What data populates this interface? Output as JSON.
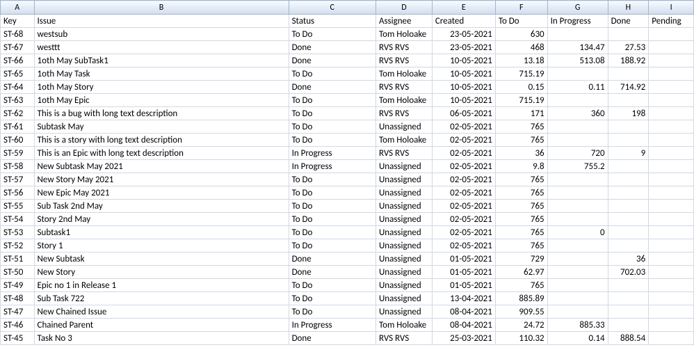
{
  "columns": [
    "A",
    "B",
    "C",
    "D",
    "E",
    "F",
    "G",
    "H",
    "I"
  ],
  "headerRow": {
    "key": "Key",
    "issue": "Issue",
    "status": "Status",
    "assignee": "Assignee",
    "created": "Created",
    "todo": "To Do",
    "inprogress": "In Progress",
    "done": "Done",
    "pending": "Pending"
  },
  "rows": [
    {
      "key": "ST-68",
      "issue": "westsub",
      "status": "To Do",
      "assignee": "Tom Holoake",
      "created": "23-05-2021",
      "todo": "630",
      "inprogress": "",
      "done": "",
      "pending": ""
    },
    {
      "key": "ST-67",
      "issue": "westtt",
      "status": "Done",
      "assignee": "RVS RVS",
      "created": "23-05-2021",
      "todo": "468",
      "inprogress": "134.47",
      "done": "27.53",
      "pending": ""
    },
    {
      "key": "ST-66",
      "issue": "1oth May SubTask1",
      "status": "Done",
      "assignee": "RVS RVS",
      "created": "10-05-2021",
      "todo": "13.18",
      "inprogress": "513.08",
      "done": "188.92",
      "pending": ""
    },
    {
      "key": "ST-65",
      "issue": "1oth May Task",
      "status": "To Do",
      "assignee": "Tom Holoake",
      "created": "10-05-2021",
      "todo": "715.19",
      "inprogress": "",
      "done": "",
      "pending": ""
    },
    {
      "key": "ST-64",
      "issue": "1oth May Story",
      "status": "Done",
      "assignee": "RVS RVS",
      "created": "10-05-2021",
      "todo": "0.15",
      "inprogress": "0.11",
      "done": "714.92",
      "pending": ""
    },
    {
      "key": "ST-63",
      "issue": "1oth May Epic",
      "status": "To Do",
      "assignee": "Tom Holoake",
      "created": "10-05-2021",
      "todo": "715.19",
      "inprogress": "",
      "done": "",
      "pending": ""
    },
    {
      "key": "ST-62",
      "issue": "This is a bug with long text description",
      "status": "To Do",
      "assignee": "RVS RVS",
      "created": "06-05-2021",
      "todo": "171",
      "inprogress": "360",
      "done": "198",
      "pending": ""
    },
    {
      "key": "ST-61",
      "issue": "Subtask May",
      "status": "To Do",
      "assignee": "Unassigned",
      "created": "02-05-2021",
      "todo": "765",
      "inprogress": "",
      "done": "",
      "pending": ""
    },
    {
      "key": "ST-60",
      "issue": "This is a story with long text description",
      "status": "To Do",
      "assignee": "Tom Holoake",
      "created": "02-05-2021",
      "todo": "765",
      "inprogress": "",
      "done": "",
      "pending": ""
    },
    {
      "key": "ST-59",
      "issue": "This is an Epic with long text description",
      "status": "In Progress",
      "assignee": "RVS RVS",
      "created": "02-05-2021",
      "todo": "36",
      "inprogress": "720",
      "done": "9",
      "pending": ""
    },
    {
      "key": "ST-58",
      "issue": "New Subtask May 2021",
      "status": "In Progress",
      "assignee": "Unassigned",
      "created": "02-05-2021",
      "todo": "9.8",
      "inprogress": "755.2",
      "done": "",
      "pending": ""
    },
    {
      "key": "ST-57",
      "issue": "New Story May 2021",
      "status": "To Do",
      "assignee": "Unassigned",
      "created": "02-05-2021",
      "todo": "765",
      "inprogress": "",
      "done": "",
      "pending": ""
    },
    {
      "key": "ST-56",
      "issue": "New Epic May 2021",
      "status": "To Do",
      "assignee": "Unassigned",
      "created": "02-05-2021",
      "todo": "765",
      "inprogress": "",
      "done": "",
      "pending": ""
    },
    {
      "key": "ST-55",
      "issue": "Sub Task 2nd May",
      "status": "To Do",
      "assignee": "Unassigned",
      "created": "02-05-2021",
      "todo": "765",
      "inprogress": "",
      "done": "",
      "pending": ""
    },
    {
      "key": "ST-54",
      "issue": "Story 2nd May",
      "status": "To Do",
      "assignee": "Unassigned",
      "created": "02-05-2021",
      "todo": "765",
      "inprogress": "",
      "done": "",
      "pending": ""
    },
    {
      "key": "ST-53",
      "issue": "Subtask1",
      "status": "To Do",
      "assignee": "Unassigned",
      "created": "02-05-2021",
      "todo": "765",
      "inprogress": "0",
      "done": "",
      "pending": ""
    },
    {
      "key": "ST-52",
      "issue": "Story 1",
      "status": "To Do",
      "assignee": "Unassigned",
      "created": "02-05-2021",
      "todo": "765",
      "inprogress": "",
      "done": "",
      "pending": ""
    },
    {
      "key": "ST-51",
      "issue": "New Subtask",
      "status": "Done",
      "assignee": "Unassigned",
      "created": "01-05-2021",
      "todo": "729",
      "inprogress": "",
      "done": "36",
      "pending": ""
    },
    {
      "key": "ST-50",
      "issue": "New Story",
      "status": "Done",
      "assignee": "Unassigned",
      "created": "01-05-2021",
      "todo": "62.97",
      "inprogress": "",
      "done": "702.03",
      "pending": ""
    },
    {
      "key": "ST-49",
      "issue": "Epic no 1 in Release 1",
      "status": "To Do",
      "assignee": "Unassigned",
      "created": "01-05-2021",
      "todo": "765",
      "inprogress": "",
      "done": "",
      "pending": ""
    },
    {
      "key": "ST-48",
      "issue": "Sub Task 722",
      "status": "To Do",
      "assignee": "Unassigned",
      "created": "13-04-2021",
      "todo": "885.89",
      "inprogress": "",
      "done": "",
      "pending": ""
    },
    {
      "key": "ST-47",
      "issue": "New Chained Issue",
      "status": "To Do",
      "assignee": "Unassigned",
      "created": "08-04-2021",
      "todo": "909.55",
      "inprogress": "",
      "done": "",
      "pending": ""
    },
    {
      "key": "ST-46",
      "issue": "Chained Parent",
      "status": "In Progress",
      "assignee": "Tom Holoake",
      "created": "08-04-2021",
      "todo": "24.72",
      "inprogress": "885.33",
      "done": "",
      "pending": ""
    },
    {
      "key": "ST-45",
      "issue": "Task No 3",
      "status": "Done",
      "assignee": "RVS RVS",
      "created": "25-03-2021",
      "todo": "110.32",
      "inprogress": "0.14",
      "done": "888.54",
      "pending": ""
    }
  ]
}
